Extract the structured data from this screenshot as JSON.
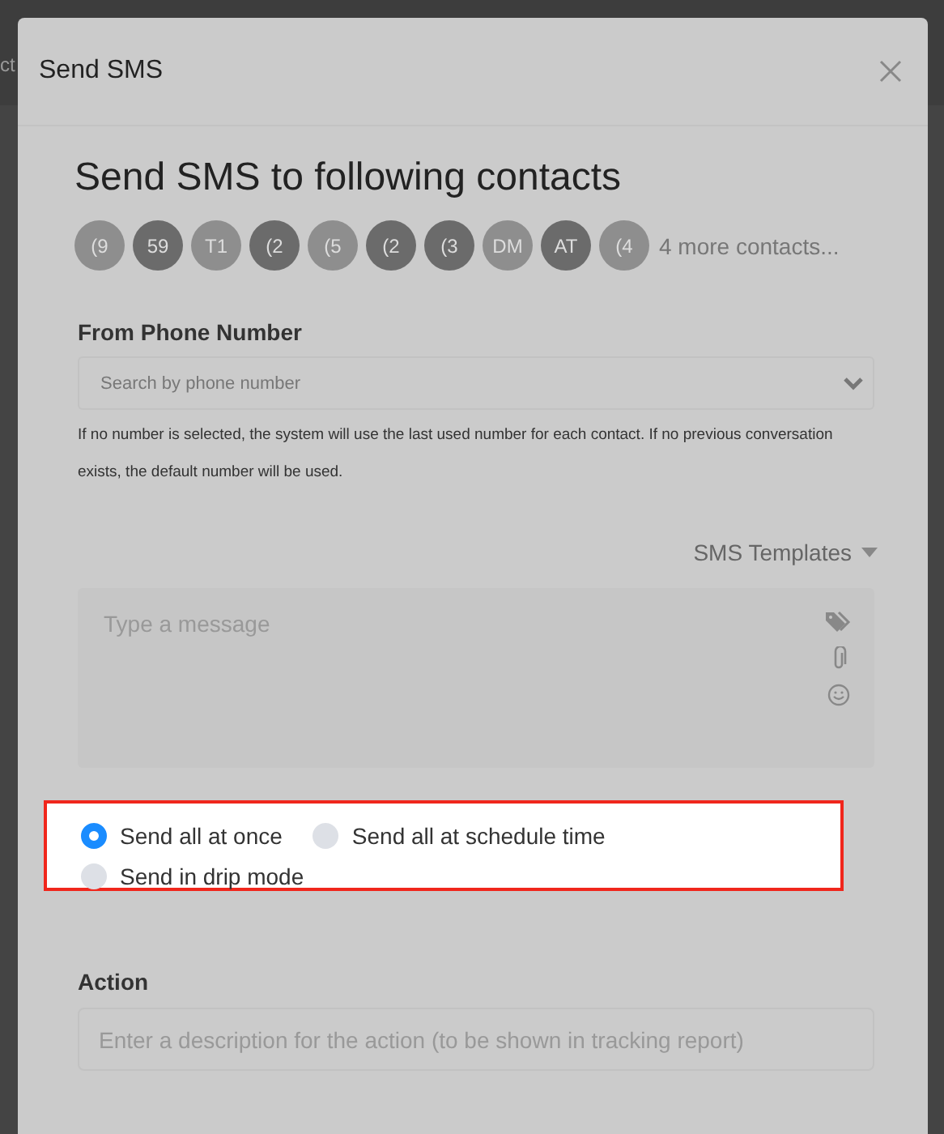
{
  "background_text": "ct",
  "dialog": {
    "title": "Send SMS",
    "heading": "Send SMS to following contacts",
    "contacts": [
      {
        "initials": "(9",
        "color": "#8e8e8e"
      },
      {
        "initials": "59",
        "color": "#6b6b6b"
      },
      {
        "initials": "T1",
        "color": "#8e8e8e"
      },
      {
        "initials": "(2",
        "color": "#6b6b6b"
      },
      {
        "initials": "(5",
        "color": "#8e8e8e"
      },
      {
        "initials": "(2",
        "color": "#6b6b6b"
      },
      {
        "initials": "(3",
        "color": "#6b6b6b"
      },
      {
        "initials": "DM",
        "color": "#8e8e8e"
      },
      {
        "initials": "AT",
        "color": "#6b6b6b"
      },
      {
        "initials": "(4",
        "color": "#8e8e8e"
      }
    ],
    "more_contacts": "4 more contacts...",
    "from_label": "From Phone Number",
    "from_placeholder": "Search by phone number",
    "from_help": "If no number is selected, the system will use the last used number for each contact. If no previous conversation exists, the default number will be used.",
    "templates": "SMS Templates",
    "message_placeholder": "Type a message",
    "send_modes": [
      {
        "label": "Send all at once",
        "selected": true
      },
      {
        "label": "Send all at schedule time",
        "selected": false
      },
      {
        "label": "Send in drip mode",
        "selected": false
      }
    ],
    "action_label": "Action",
    "action_placeholder": "Enter a description for the action (to be shown in tracking report)"
  }
}
